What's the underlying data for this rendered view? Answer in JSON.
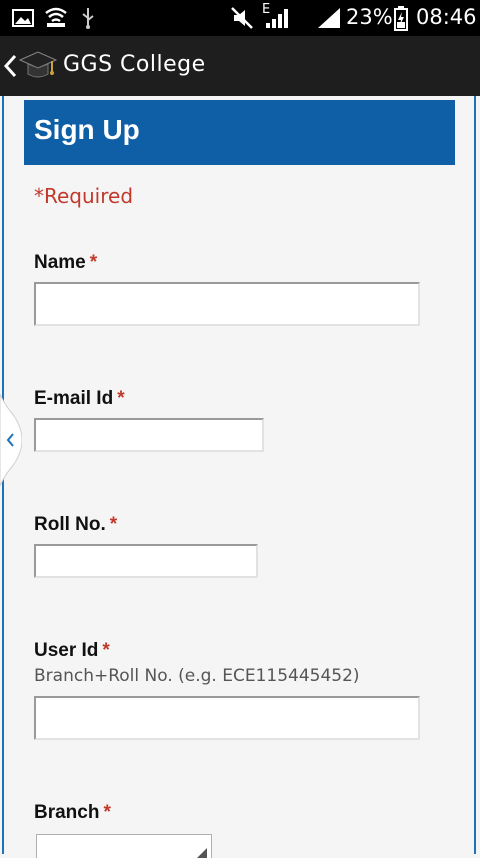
{
  "status_bar": {
    "battery_percent": "23%",
    "time": "08:46",
    "network_type": "E",
    "icons": [
      "image-icon",
      "wifi-icon",
      "usb-icon",
      "mute-icon",
      "signal-icon",
      "battery-icon"
    ]
  },
  "app_bar": {
    "title": "GGS College",
    "back_icon": "chevron-left-icon",
    "app_icon": "graduation-cap-icon"
  },
  "form": {
    "heading": "Sign Up",
    "required_note": "*Required",
    "required_marker": "*",
    "fields": [
      {
        "label": "Name",
        "value": "",
        "placeholder": ""
      },
      {
        "label": "E-mail Id",
        "value": "",
        "placeholder": ""
      },
      {
        "label": "Roll No.",
        "value": "",
        "placeholder": ""
      },
      {
        "label": "User Id",
        "hint": "Branch+Roll No. (e.g. ECE115445452)",
        "value": "",
        "placeholder": ""
      },
      {
        "label": "Branch",
        "selected": ""
      }
    ]
  },
  "colors": {
    "header_bg": "#0e5fa6",
    "accent": "#1e73b8",
    "required": "#c0392b"
  }
}
